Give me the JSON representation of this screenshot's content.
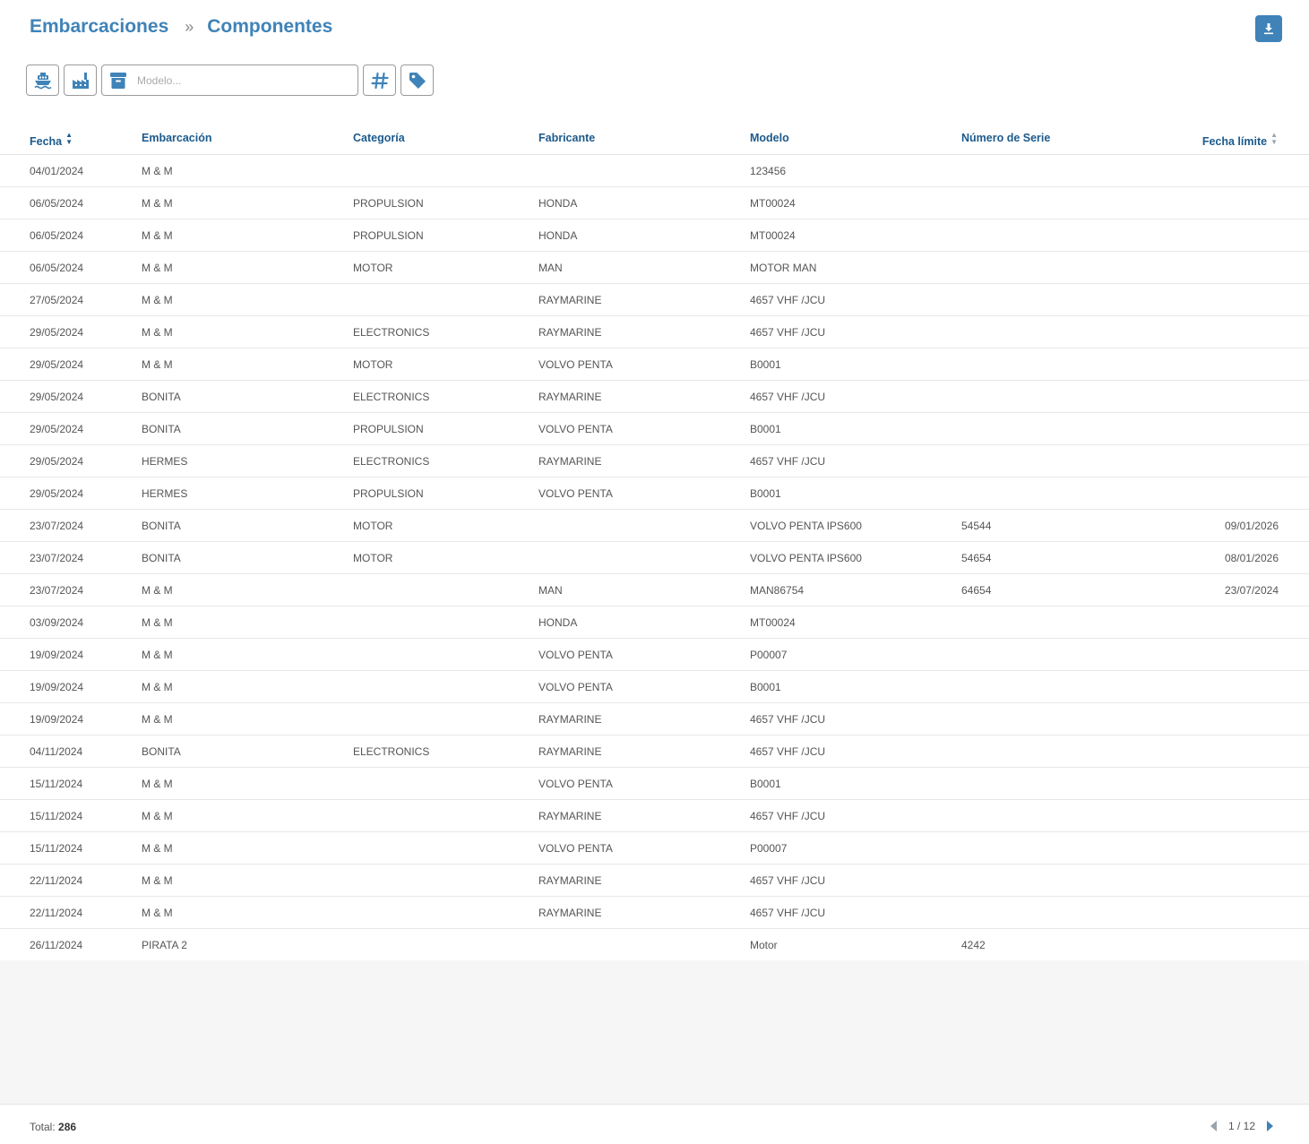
{
  "breadcrumb": {
    "root": "Embarcaciones",
    "separator": "»",
    "current": "Componentes"
  },
  "toolbar": {
    "search_placeholder": "Modelo...",
    "icons": [
      "ship-icon",
      "factory-icon",
      "archive-icon",
      "hash-icon",
      "tag-icon"
    ]
  },
  "colors": {
    "accent": "#3f83b8",
    "header_text": "#1c5a8c",
    "footer_bg": "#f6f6f6"
  },
  "table": {
    "columns": [
      "Fecha",
      "Embarcación",
      "Categoría",
      "Fabricante",
      "Modelo",
      "Número de Serie",
      "Fecha límite"
    ],
    "rows": [
      [
        "04/01/2024",
        "M & M",
        "",
        "",
        "123456",
        "",
        ""
      ],
      [
        "06/05/2024",
        "M & M",
        "PROPULSION",
        "HONDA",
        "MT00024",
        "",
        ""
      ],
      [
        "06/05/2024",
        "M & M",
        "PROPULSION",
        "HONDA",
        "MT00024",
        "",
        ""
      ],
      [
        "06/05/2024",
        "M & M",
        "MOTOR",
        "MAN",
        "MOTOR MAN",
        "",
        ""
      ],
      [
        "27/05/2024",
        "M & M",
        "",
        "RAYMARINE",
        "4657 VHF /JCU",
        "",
        ""
      ],
      [
        "29/05/2024",
        "M & M",
        "ELECTRONICS",
        "RAYMARINE",
        "4657 VHF /JCU",
        "",
        ""
      ],
      [
        "29/05/2024",
        "M & M",
        "MOTOR",
        "VOLVO PENTA",
        "B0001",
        "",
        ""
      ],
      [
        "29/05/2024",
        "BONITA",
        "ELECTRONICS",
        "RAYMARINE",
        "4657 VHF /JCU",
        "",
        ""
      ],
      [
        "29/05/2024",
        "BONITA",
        "PROPULSION",
        "VOLVO PENTA",
        "B0001",
        "",
        ""
      ],
      [
        "29/05/2024",
        "HERMES",
        "ELECTRONICS",
        "RAYMARINE",
        "4657 VHF /JCU",
        "",
        ""
      ],
      [
        "29/05/2024",
        "HERMES",
        "PROPULSION",
        "VOLVO PENTA",
        "B0001",
        "",
        ""
      ],
      [
        "23/07/2024",
        "BONITA",
        "MOTOR",
        "",
        "VOLVO PENTA IPS600",
        "54544",
        "09/01/2026"
      ],
      [
        "23/07/2024",
        "BONITA",
        "MOTOR",
        "",
        "VOLVO PENTA IPS600",
        "54654",
        "08/01/2026"
      ],
      [
        "23/07/2024",
        "M & M",
        "",
        "MAN",
        "MAN86754",
        "64654",
        "23/07/2024"
      ],
      [
        "03/09/2024",
        "M & M",
        "",
        "HONDA",
        "MT00024",
        "",
        ""
      ],
      [
        "19/09/2024",
        "M & M",
        "",
        "VOLVO PENTA",
        "P00007",
        "",
        ""
      ],
      [
        "19/09/2024",
        "M & M",
        "",
        "VOLVO PENTA",
        "B0001",
        "",
        ""
      ],
      [
        "19/09/2024",
        "M & M",
        "",
        "RAYMARINE",
        "4657 VHF /JCU",
        "",
        ""
      ],
      [
        "04/11/2024",
        "BONITA",
        "ELECTRONICS",
        "RAYMARINE",
        "4657 VHF /JCU",
        "",
        ""
      ],
      [
        "15/11/2024",
        "M & M",
        "",
        "VOLVO PENTA",
        "B0001",
        "",
        ""
      ],
      [
        "15/11/2024",
        "M & M",
        "",
        "RAYMARINE",
        "4657 VHF /JCU",
        "",
        ""
      ],
      [
        "15/11/2024",
        "M & M",
        "",
        "VOLVO PENTA",
        "P00007",
        "",
        ""
      ],
      [
        "22/11/2024",
        "M & M",
        "",
        "RAYMARINE",
        "4657 VHF /JCU",
        "",
        ""
      ],
      [
        "22/11/2024",
        "M & M",
        "",
        "RAYMARINE",
        "4657 VHF /JCU",
        "",
        ""
      ],
      [
        "26/11/2024",
        "PIRATA 2",
        "",
        "",
        "Motor",
        "4242",
        ""
      ]
    ]
  },
  "footer": {
    "total_label": "Total:",
    "total_value": "286",
    "page": "1 / 12"
  }
}
